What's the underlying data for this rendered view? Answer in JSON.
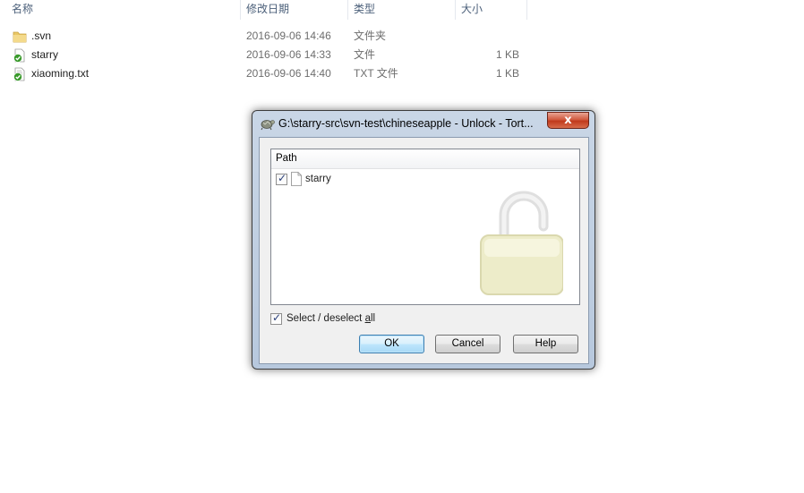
{
  "explorer": {
    "columns": {
      "name": "名称",
      "date": "修改日期",
      "type": "类型",
      "size": "大小"
    },
    "files": [
      {
        "name": ".svn",
        "date": "2016-09-06 14:46",
        "type": "文件夹",
        "size": "",
        "icon": "folder-icon"
      },
      {
        "name": "starry",
        "date": "2016-09-06 14:33",
        "type": "文件",
        "size": "1 KB",
        "icon": "svn-normal-file-icon"
      },
      {
        "name": "xiaoming.txt",
        "date": "2016-09-06 14:40",
        "type": "TXT 文件",
        "size": "1 KB",
        "icon": "svn-normal-file-icon"
      }
    ]
  },
  "dialog": {
    "title": "G:\\starry-src\\svn-test\\chineseapple - Unlock - Tort...",
    "close_label": "x",
    "list": {
      "column_header": "Path",
      "items": [
        {
          "label": "starry",
          "checked": true
        }
      ]
    },
    "select_all": {
      "label_prefix": "Select / deselect ",
      "label_accel": "a",
      "label_suffix": "ll",
      "checked": true
    },
    "buttons": {
      "ok": "OK",
      "cancel": "Cancel",
      "help": "Help"
    }
  },
  "colors": {
    "accent_default_button": "#3c7fb1",
    "close_button": "#c03a1c",
    "svn_overlay_green": "#3a9a2c",
    "folder_yellow": "#f2d27a"
  }
}
